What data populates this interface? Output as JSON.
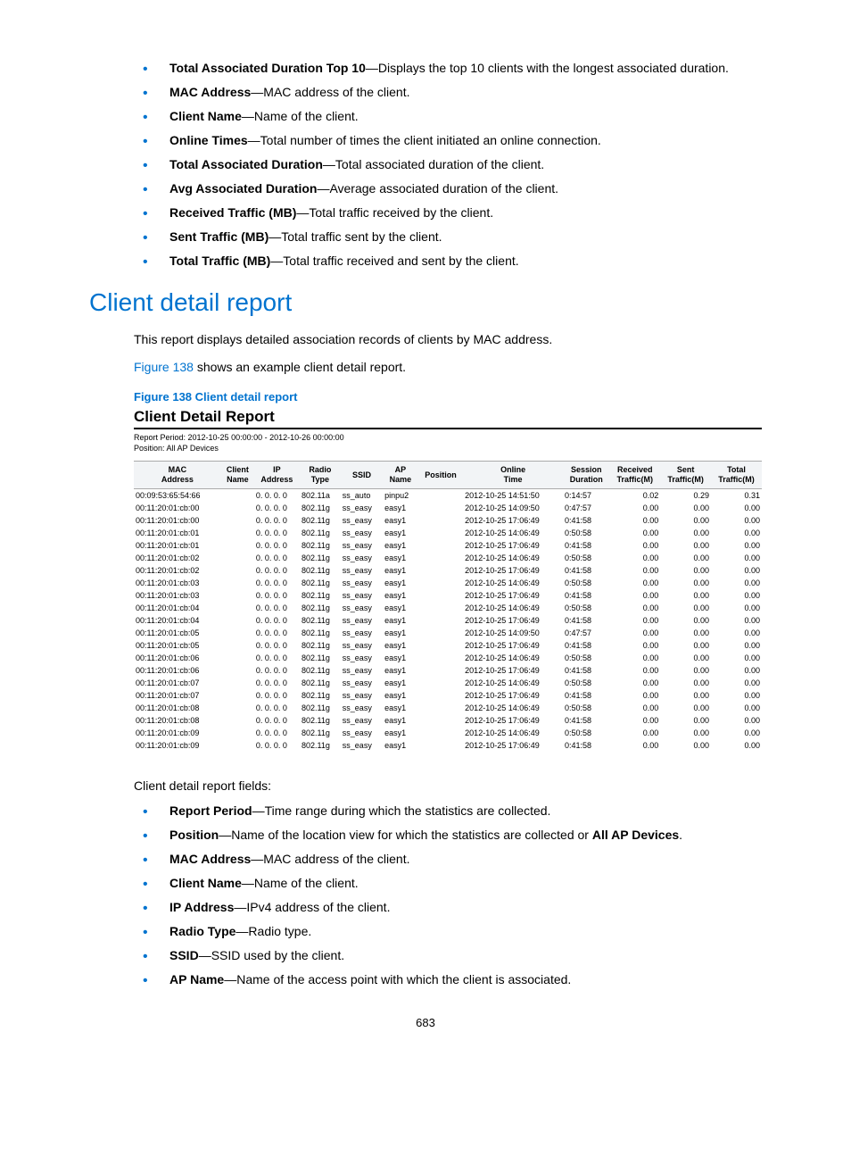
{
  "topFields": [
    {
      "term": "Total Associated Duration Top 10",
      "desc": "—Displays the top 10 clients with the longest associated duration."
    },
    {
      "term": "MAC Address",
      "desc": "—MAC address of the client."
    },
    {
      "term": "Client Name",
      "desc": "—Name of the client."
    },
    {
      "term": "Online Times",
      "desc": "—Total number of times the client initiated an online connection."
    },
    {
      "term": "Total Associated Duration",
      "desc": "—Total associated duration of the client."
    },
    {
      "term": "Avg Associated Duration",
      "desc": "—Average associated duration of the client."
    },
    {
      "term": "Received Traffic (MB)",
      "desc": "—Total traffic received by the client."
    },
    {
      "term": "Sent Traffic (MB)",
      "desc": "—Total traffic sent by the client."
    },
    {
      "term": "Total Traffic (MB)",
      "desc": "—Total traffic received and sent by the client."
    }
  ],
  "sectionTitle": "Client detail report",
  "intro1": "This report displays detailed association records of clients by MAC address.",
  "intro2a": "Figure 138",
  "intro2b": " shows an example client detail report.",
  "figureCaption": "Figure 138 Client detail report",
  "report": {
    "title": "Client Detail Report",
    "period": "Report Period: 2012-10-25 00:00:00  -  2012-10-26 00:00:00",
    "position": "Position: All AP Devices",
    "headers": [
      "MAC Address",
      "Client Name",
      "IP Address",
      "Radio Type",
      "SSID",
      "AP Name",
      "Position",
      "Online Time",
      "Session Duration",
      "Received Traffic(M)",
      "Sent Traffic(M)",
      "Total Traffic(M)"
    ],
    "rows": [
      [
        "00:09:53:65:54:66",
        "",
        "0. 0. 0. 0",
        "802.11a",
        "ss_auto",
        "pinpu2",
        "",
        "2012-10-25 14:51:50",
        "0:14:57",
        "0.02",
        "0.29",
        "0.31"
      ],
      [
        "00:11:20:01:cb:00",
        "",
        "0. 0. 0. 0",
        "802.11g",
        "ss_easy",
        "easy1",
        "",
        "2012-10-25 14:09:50",
        "0:47:57",
        "0.00",
        "0.00",
        "0.00"
      ],
      [
        "00:11:20:01:cb:00",
        "",
        "0. 0. 0. 0",
        "802.11g",
        "ss_easy",
        "easy1",
        "",
        "2012-10-25 17:06:49",
        "0:41:58",
        "0.00",
        "0.00",
        "0.00"
      ],
      [
        "00:11:20:01:cb:01",
        "",
        "0. 0. 0. 0",
        "802.11g",
        "ss_easy",
        "easy1",
        "",
        "2012-10-25 14:06:49",
        "0:50:58",
        "0.00",
        "0.00",
        "0.00"
      ],
      [
        "00:11:20:01:cb:01",
        "",
        "0. 0. 0. 0",
        "802.11g",
        "ss_easy",
        "easy1",
        "",
        "2012-10-25 17:06:49",
        "0:41:58",
        "0.00",
        "0.00",
        "0.00"
      ],
      [
        "00:11:20:01:cb:02",
        "",
        "0. 0. 0. 0",
        "802.11g",
        "ss_easy",
        "easy1",
        "",
        "2012-10-25 14:06:49",
        "0:50:58",
        "0.00",
        "0.00",
        "0.00"
      ],
      [
        "00:11:20:01:cb:02",
        "",
        "0. 0. 0. 0",
        "802.11g",
        "ss_easy",
        "easy1",
        "",
        "2012-10-25 17:06:49",
        "0:41:58",
        "0.00",
        "0.00",
        "0.00"
      ],
      [
        "00:11:20:01:cb:03",
        "",
        "0. 0. 0. 0",
        "802.11g",
        "ss_easy",
        "easy1",
        "",
        "2012-10-25 14:06:49",
        "0:50:58",
        "0.00",
        "0.00",
        "0.00"
      ],
      [
        "00:11:20:01:cb:03",
        "",
        "0. 0. 0. 0",
        "802.11g",
        "ss_easy",
        "easy1",
        "",
        "2012-10-25 17:06:49",
        "0:41:58",
        "0.00",
        "0.00",
        "0.00"
      ],
      [
        "00:11:20:01:cb:04",
        "",
        "0. 0. 0. 0",
        "802.11g",
        "ss_easy",
        "easy1",
        "",
        "2012-10-25 14:06:49",
        "0:50:58",
        "0.00",
        "0.00",
        "0.00"
      ],
      [
        "00:11:20:01:cb:04",
        "",
        "0. 0. 0. 0",
        "802.11g",
        "ss_easy",
        "easy1",
        "",
        "2012-10-25 17:06:49",
        "0:41:58",
        "0.00",
        "0.00",
        "0.00"
      ],
      [
        "00:11:20:01:cb:05",
        "",
        "0. 0. 0. 0",
        "802.11g",
        "ss_easy",
        "easy1",
        "",
        "2012-10-25 14:09:50",
        "0:47:57",
        "0.00",
        "0.00",
        "0.00"
      ],
      [
        "00:11:20:01:cb:05",
        "",
        "0. 0. 0. 0",
        "802.11g",
        "ss_easy",
        "easy1",
        "",
        "2012-10-25 17:06:49",
        "0:41:58",
        "0.00",
        "0.00",
        "0.00"
      ],
      [
        "00:11:20:01:cb:06",
        "",
        "0. 0. 0. 0",
        "802.11g",
        "ss_easy",
        "easy1",
        "",
        "2012-10-25 14:06:49",
        "0:50:58",
        "0.00",
        "0.00",
        "0.00"
      ],
      [
        "00:11:20:01:cb:06",
        "",
        "0. 0. 0. 0",
        "802.11g",
        "ss_easy",
        "easy1",
        "",
        "2012-10-25 17:06:49",
        "0:41:58",
        "0.00",
        "0.00",
        "0.00"
      ],
      [
        "00:11:20:01:cb:07",
        "",
        "0. 0. 0. 0",
        "802.11g",
        "ss_easy",
        "easy1",
        "",
        "2012-10-25 14:06:49",
        "0:50:58",
        "0.00",
        "0.00",
        "0.00"
      ],
      [
        "00:11:20:01:cb:07",
        "",
        "0. 0. 0. 0",
        "802.11g",
        "ss_easy",
        "easy1",
        "",
        "2012-10-25 17:06:49",
        "0:41:58",
        "0.00",
        "0.00",
        "0.00"
      ],
      [
        "00:11:20:01:cb:08",
        "",
        "0. 0. 0. 0",
        "802.11g",
        "ss_easy",
        "easy1",
        "",
        "2012-10-25 14:06:49",
        "0:50:58",
        "0.00",
        "0.00",
        "0.00"
      ],
      [
        "00:11:20:01:cb:08",
        "",
        "0. 0. 0. 0",
        "802.11g",
        "ss_easy",
        "easy1",
        "",
        "2012-10-25 17:06:49",
        "0:41:58",
        "0.00",
        "0.00",
        "0.00"
      ],
      [
        "00:11:20:01:cb:09",
        "",
        "0. 0. 0. 0",
        "802.11g",
        "ss_easy",
        "easy1",
        "",
        "2012-10-25 14:06:49",
        "0:50:58",
        "0.00",
        "0.00",
        "0.00"
      ],
      [
        "00:11:20:01:cb:09",
        "",
        "0. 0. 0. 0",
        "802.11g",
        "ss_easy",
        "easy1",
        "",
        "2012-10-25 17:06:49",
        "0:41:58",
        "0.00",
        "0.00",
        "0.00"
      ]
    ]
  },
  "fieldsIntro": "Client detail report fields:",
  "bottomFields": [
    {
      "term": "Report Period",
      "desc": "—Time range during which the statistics are collected."
    },
    {
      "term": "Position",
      "desc": "—Name of the location view for which the statistics are collected or ",
      "bold2": "All AP Devices",
      "desc2": "."
    },
    {
      "term": "MAC Address",
      "desc": "—MAC address of the client."
    },
    {
      "term": "Client Name",
      "desc": "—Name of the client."
    },
    {
      "term": "IP Address",
      "desc": "—IPv4 address of the client."
    },
    {
      "term": "Radio Type",
      "desc": "—Radio type."
    },
    {
      "term": "SSID",
      "desc": "—SSID used by the client."
    },
    {
      "term": "AP Name",
      "desc": "—Name of the access point with which the client is associated."
    }
  ],
  "pageNumber": "683"
}
